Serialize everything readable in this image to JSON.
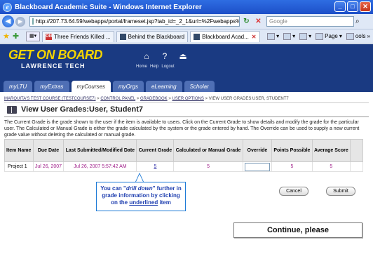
{
  "window": {
    "title": "Blackboard Academic Suite - Windows Internet Explorer",
    "minimize": "_",
    "maximize": "□",
    "close": "✕"
  },
  "address_bar": {
    "url": "http://207.73.64.59/webapps/portal/frameset.jsp?tab_id=_2_1&url=%2Fwebapps%",
    "search_placeholder": "Google"
  },
  "browser_tabs": [
    {
      "label": "Three Friends Killed ...",
      "favicon": "ON",
      "active": false
    },
    {
      "label": "Behind the Blackboard",
      "favicon": "",
      "active": false
    },
    {
      "label": "Blackboard Acad...",
      "favicon": "",
      "active": true
    }
  ],
  "command_bar": {
    "page": "Page",
    "tools": "ools"
  },
  "site": {
    "logo_top": "GET ON BOARD",
    "logo_bottom": "LAWRENCE TECH",
    "header_links": [
      "Home",
      "Help",
      "Logout"
    ],
    "tabs": [
      {
        "label": "myLTU",
        "active": false
      },
      {
        "label": "myExtras",
        "active": false
      },
      {
        "label": "myCourses",
        "active": true
      },
      {
        "label": "myOrgs",
        "active": false
      },
      {
        "label": "eLearning",
        "active": false
      },
      {
        "label": "Scholar",
        "active": false
      }
    ]
  },
  "breadcrumb": {
    "items": [
      "MARQUITA'S TEST COURSE (TESTCOURSE7)",
      "CONTROL PANEL",
      "GRADEBOOK",
      "USER OPTIONS"
    ],
    "separator": " > ",
    "current": " > VIEW USER GRADES:USER, STUDENT7"
  },
  "page_title": "View User Grades:User, Student7",
  "description": "The Current Grade is the grade shown to the user if the item is available to users. Click on the Current Grade to show details and modify the grade for the particular user. The Calculated or Manual Grade is either the grade calculated by the system or the grade entered by hand. The Override can be used to supply a new current grade value without deleting the calculated or manual grade.",
  "table": {
    "headers": [
      "Item Name",
      "Due Date",
      "Last Submitted/Modified Date",
      "Current Grade",
      "Calculated or Manual Grade",
      "Override",
      "Points Possible",
      "Average Score"
    ],
    "rows": [
      {
        "item_name": "Project 1",
        "due_date": "Jul 26, 2007",
        "last_modified": "Jul 26, 2007 5:57:42 AM",
        "current_grade": "5",
        "calculated_grade": "5",
        "override": "",
        "points_possible": "5",
        "average_score": "5"
      }
    ]
  },
  "callout": {
    "line1a": "You can \"",
    "line1b": "drill down",
    "line1c": "\" further in",
    "line2": "grade information by clicking",
    "line3a": "on the ",
    "line3b": "underlined",
    "line3c": " item"
  },
  "buttons": {
    "cancel": "Cancel",
    "submit": "Submit",
    "continue": "Continue, please"
  },
  "colors": {
    "header_bg": "#1a3a82",
    "logo_yellow": "#f5d400",
    "link_purple": "#a0208a",
    "callout_blue": "#2040b0"
  }
}
